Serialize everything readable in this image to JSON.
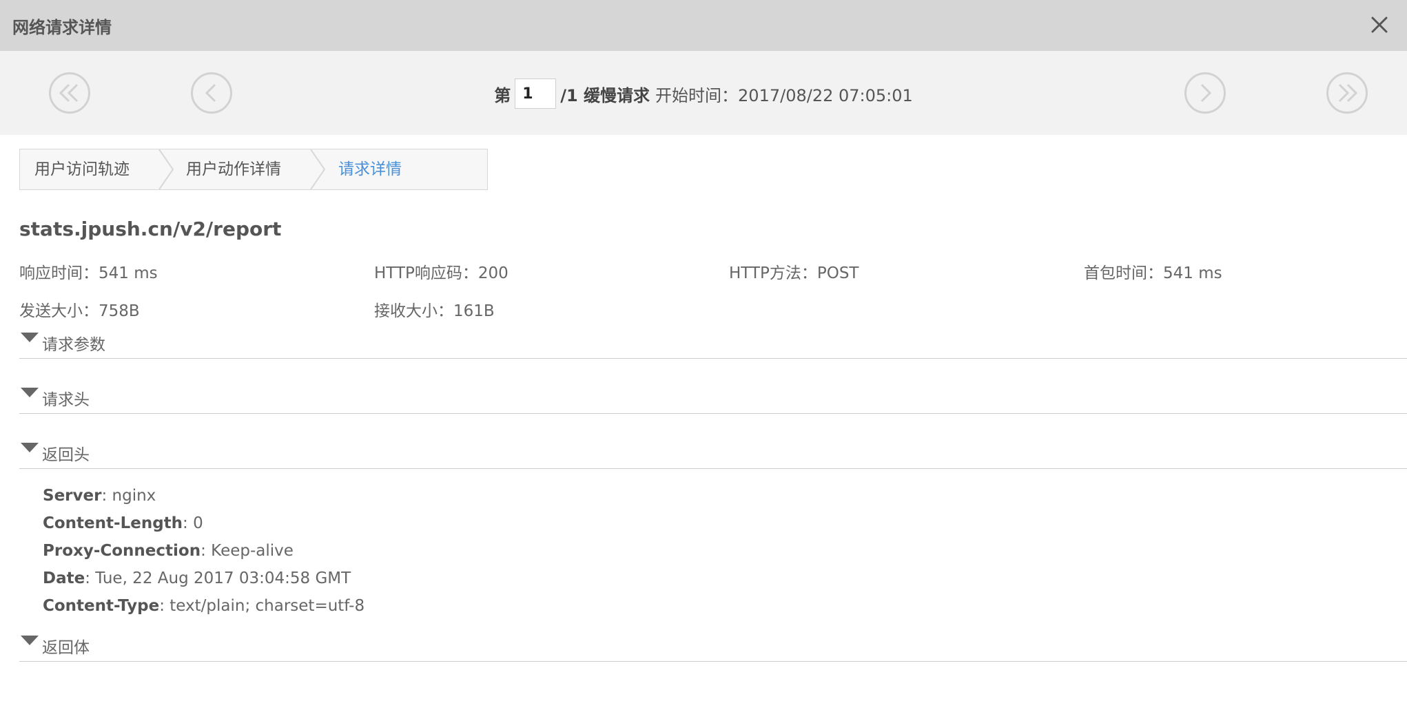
{
  "window": {
    "title": "网络请求详情"
  },
  "pager": {
    "prefix": "第",
    "page_value": "1",
    "suffix": "/1 缓慢请求",
    "start_time": "开始时间：2017/08/22 07:05:01"
  },
  "breadcrumb": [
    "用户访问轨迹",
    "用户动作详情",
    "请求详情"
  ],
  "request": {
    "url": "stats.jpush.cn/v2/report",
    "metrics": [
      "响应时间：541 ms",
      "HTTP响应码：200",
      "HTTP方法：POST",
      "首包时间：541 ms",
      "发送大小：758B",
      "接收大小：161B"
    ]
  },
  "sections": {
    "request_params": "请求参数",
    "request_headers": "请求头",
    "response_headers": "返回头",
    "response_body": "返回体"
  },
  "response_headers": [
    {
      "key": "Server",
      "value": ": nginx"
    },
    {
      "key": "Content-Length",
      "value": ": 0"
    },
    {
      "key": "Proxy-Connection",
      "value": ": Keep-alive"
    },
    {
      "key": "Date",
      "value": ": Tue, 22 Aug 2017 03:04:58 GMT"
    },
    {
      "key": "Content-Type",
      "value": ": text/plain; charset=utf-8"
    }
  ],
  "icons": {
    "close": "close-icon",
    "first": "double-chevron-left-icon",
    "prev": "chevron-left-icon",
    "next": "chevron-right-icon",
    "last": "double-chevron-right-icon",
    "expand": "triangle-down-icon"
  },
  "colors": {
    "active_crumb": "#4a90d9",
    "titlebar": "#d6d6d6",
    "pager_bg": "#f2f2f2"
  }
}
